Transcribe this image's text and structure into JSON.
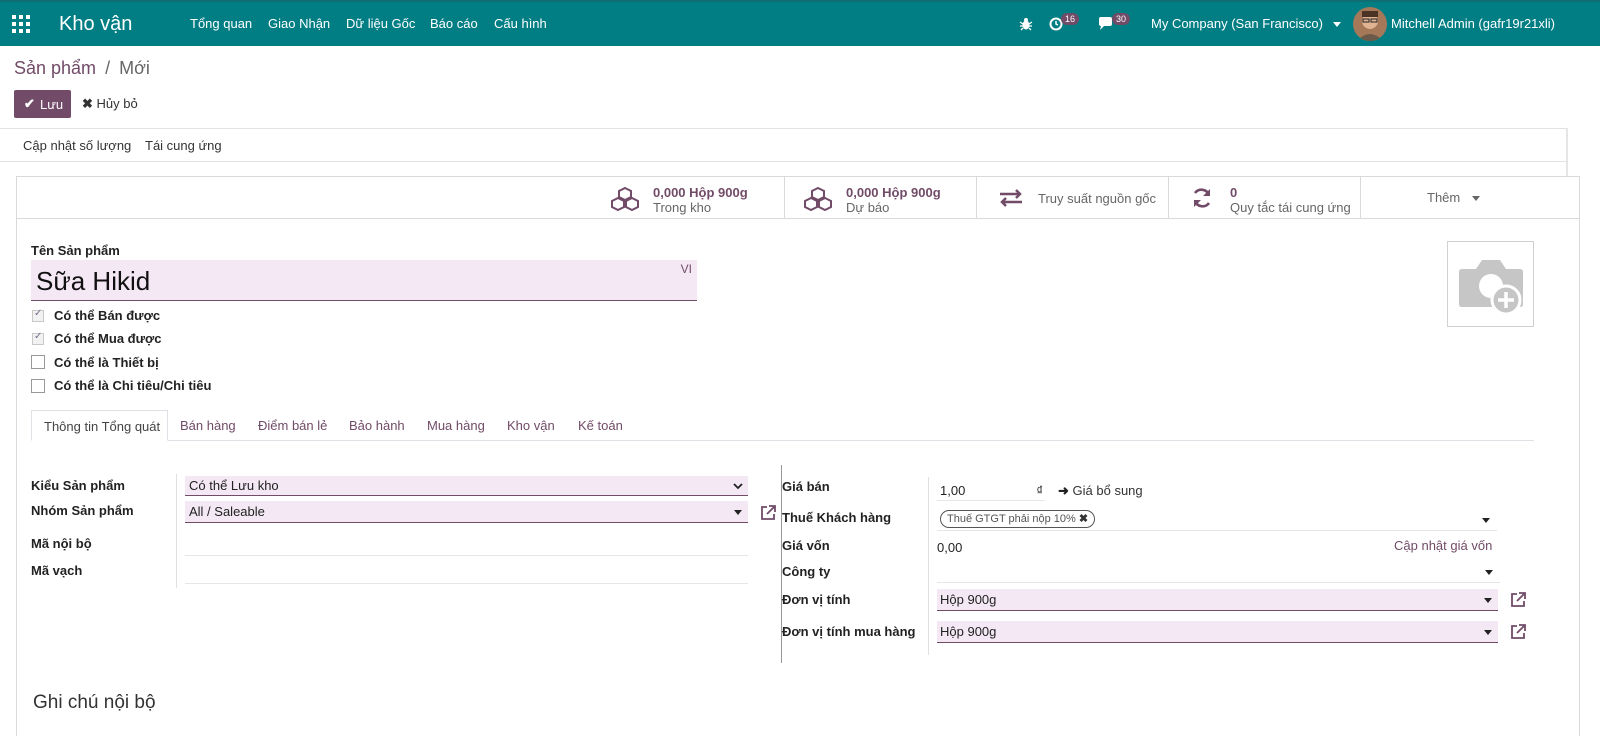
{
  "navbar": {
    "app_name": "Kho vận",
    "menu": [
      "Tổng quan",
      "Giao Nhận",
      "Dữ liệu Gốc",
      "Báo cáo",
      "Cấu hình"
    ],
    "activity_count": "16",
    "messages_count": "30",
    "company": "My Company (San Francisco)",
    "user": "Mitchell Admin (gafr19r21xli)"
  },
  "breadcrumb": {
    "parent": "Sản phẩm",
    "separator": "/",
    "current": "Mới"
  },
  "actions": {
    "save": "Lưu",
    "discard": "Hủy bỏ"
  },
  "toolbar": {
    "update_qty": "Cập nhật số lượng",
    "replenish": "Tái cung ứng"
  },
  "smart_buttons": {
    "on_hand_value": "0,000 Hộp 900g",
    "on_hand_label": "Trong kho",
    "forecast_value": "0,000 Hộp 900g",
    "forecast_label": "Dự báo",
    "traceability_label": "Truy suất nguồn gốc",
    "reorder_value": "0",
    "reorder_label": "Quy tắc tái cung ứng",
    "more_label": "Thêm"
  },
  "form": {
    "name_label": "Tên Sản phẩm",
    "name_value": "Sữa Hikid",
    "lang": "VI",
    "checkboxes": [
      {
        "label": "Có thể Bán được",
        "checked": true
      },
      {
        "label": "Có thể Mua được",
        "checked": true
      },
      {
        "label": "Có thể là Thiết bị",
        "checked": false
      },
      {
        "label": "Có thể là Chi tiêu/Chi tiêu",
        "checked": false
      }
    ],
    "tabs": [
      "Thông tin Tổng quát",
      "Bán hàng",
      "Điểm bán lẻ",
      "Bảo hành",
      "Mua hàng",
      "Kho vận",
      "Kế toán"
    ],
    "left_fields": {
      "product_type_label": "Kiểu Sản phẩm",
      "product_type_value": "Có thể Lưu kho",
      "category_label": "Nhóm Sản phẩm",
      "category_value": "All / Saleable",
      "internal_ref_label": "Mã nội bộ",
      "barcode_label": "Mã vạch"
    },
    "right_fields": {
      "sale_price_label": "Giá bán",
      "sale_price_value": "1,00",
      "currency": "₫",
      "extra_price": "Giá bổ sung",
      "customer_tax_label": "Thuế Khách hàng",
      "customer_tax_tag": "Thuế GTGT phải nộp 10%",
      "cost_label": "Giá vốn",
      "cost_value": "0,00",
      "update_cost": "Cập nhật giá vốn",
      "company_label": "Công ty",
      "uom_label": "Đơn vị tính",
      "uom_value": "Hộp 900g",
      "purchase_uom_label": "Đơn vị tính mua hàng",
      "purchase_uom_value": "Hộp 900g"
    },
    "internal_notes": "Ghi chú nội bộ"
  },
  "colors": {
    "navbar": "#017e84",
    "accent": "#714b67",
    "field_bg": "#f3e8f4"
  }
}
